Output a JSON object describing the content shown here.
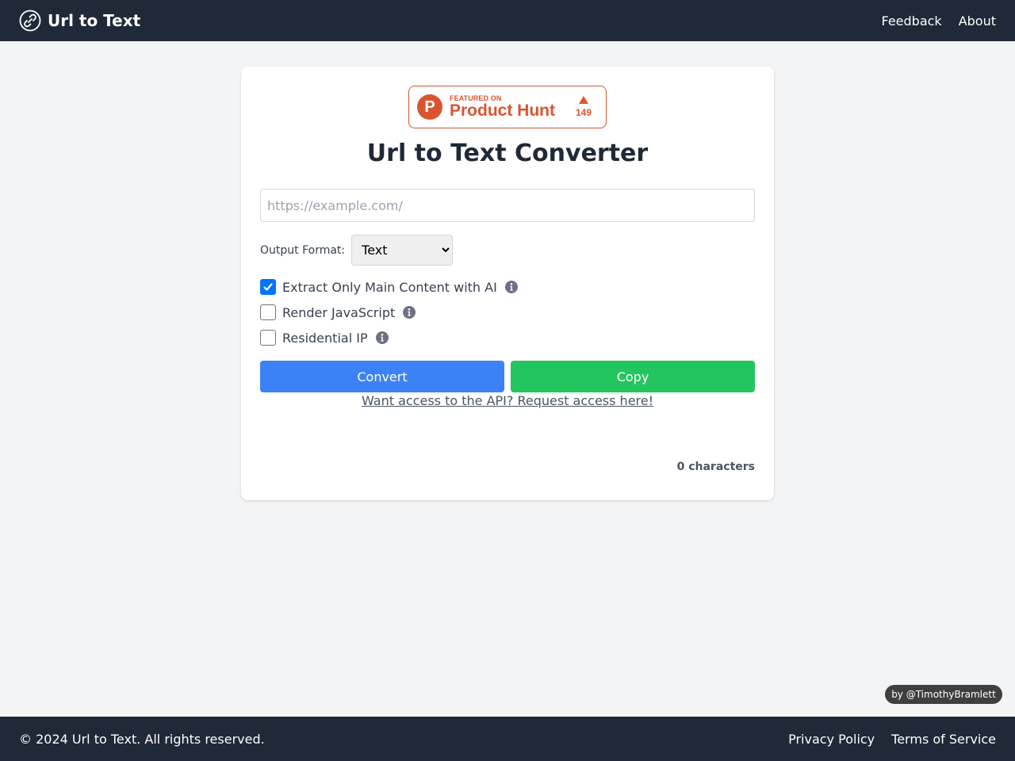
{
  "header": {
    "brand_icon": "link-icon",
    "title": "Url to Text",
    "nav": [
      {
        "label": "Feedback"
      },
      {
        "label": "About"
      }
    ]
  },
  "product_hunt": {
    "featured_label": "FEATURED ON",
    "name": "Product Hunt",
    "logo_letter": "P",
    "votes": "149",
    "color": "#da552f"
  },
  "main": {
    "title": "Url to Text Converter",
    "url_input": {
      "value": "",
      "placeholder": "https://example.com/"
    },
    "output_format": {
      "label": "Output Format:",
      "selected": "Text"
    },
    "options": [
      {
        "label": "Extract Only Main Content with AI",
        "checked": true
      },
      {
        "label": "Render JavaScript",
        "checked": false
      },
      {
        "label": "Residential IP",
        "checked": false
      }
    ],
    "convert_label": "Convert",
    "copy_label": "Copy",
    "api_link": "Want access to the API? Request access here!",
    "char_count": "0 characters"
  },
  "credit": "by @TimothyBramlett",
  "footer": {
    "copyright": "© 2024 Url to Text. All rights reserved.",
    "links": [
      {
        "label": "Privacy Policy"
      },
      {
        "label": "Terms of Service"
      }
    ]
  },
  "colors": {
    "header_bg": "#1f2937",
    "convert": "#3b82f6",
    "copy": "#22c55e",
    "checkbox": "#0075ff"
  }
}
